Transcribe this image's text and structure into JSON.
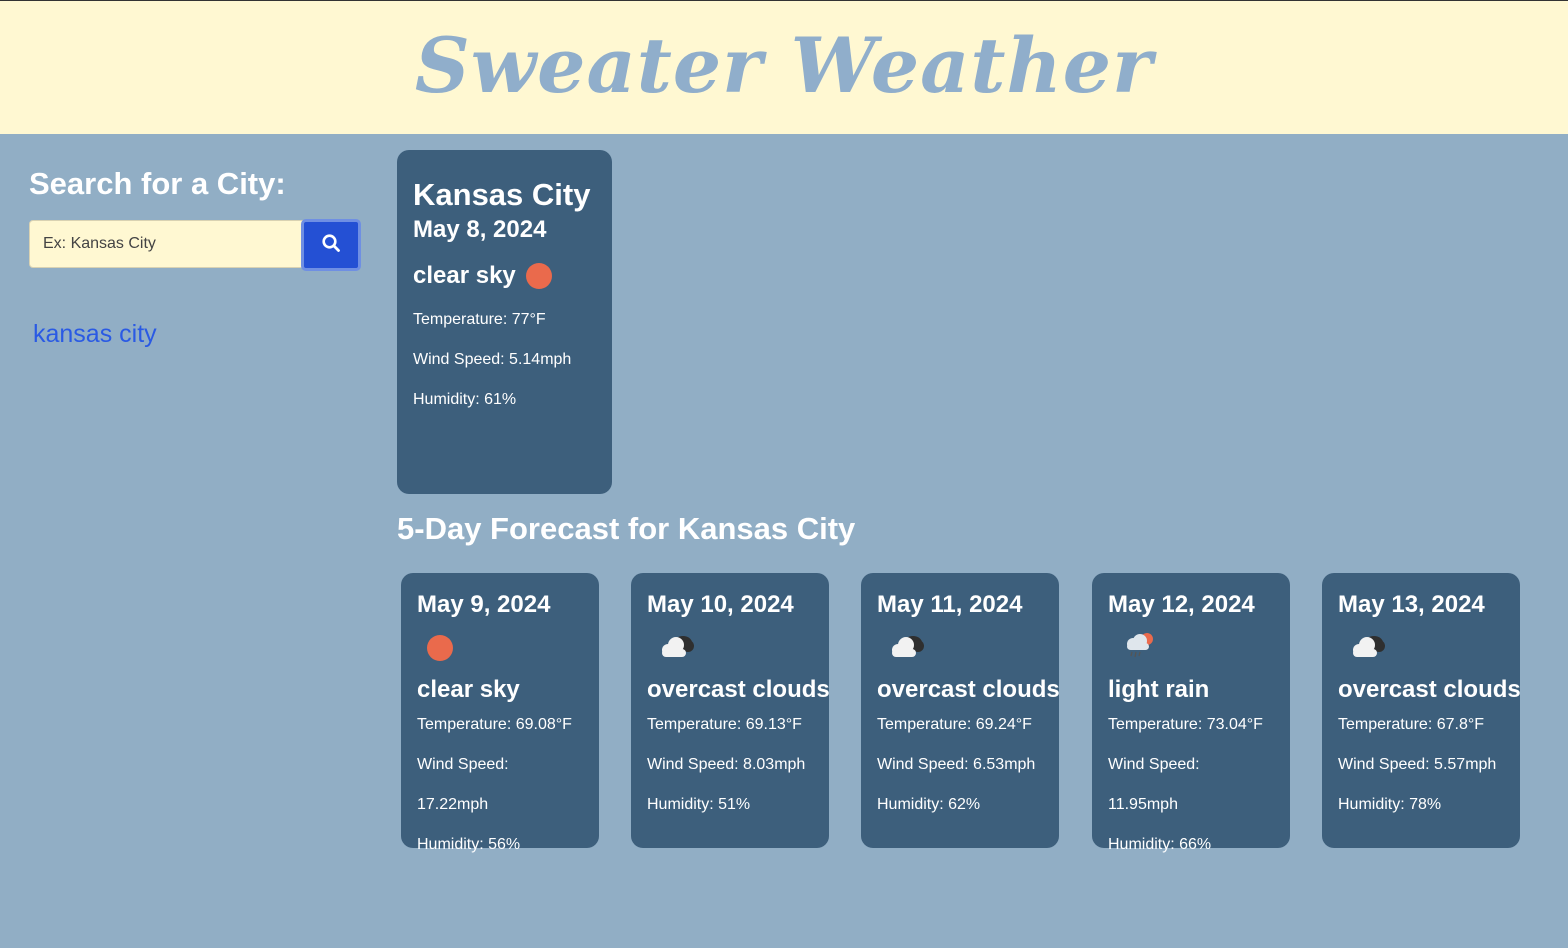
{
  "header": {
    "title": "Sweater Weather"
  },
  "search": {
    "heading": "Search for a City:",
    "placeholder": "Ex: Kansas City",
    "value": "",
    "button_icon": "search-icon"
  },
  "history": [
    {
      "label": "kansas city"
    }
  ],
  "current": {
    "city": "Kansas City",
    "date": "May 8, 2024",
    "condition": "clear sky",
    "icon": "sun-icon",
    "temperature": "Temperature: 77°F",
    "wind": "Wind Speed: 5.14mph",
    "humidity": "Humidity: 61%"
  },
  "forecast": {
    "heading": "5-Day Forecast for Kansas City",
    "days": [
      {
        "date": "May 9, 2024",
        "icon": "sun-icon",
        "condition": "clear sky",
        "temperature": "Temperature: 69.08°F",
        "wind": "Wind Speed: 17.22mph",
        "humidity": "Humidity: 56%"
      },
      {
        "date": "May 10, 2024",
        "icon": "overcast-clouds-icon",
        "condition": "overcast clouds",
        "temperature": "Temperature: 69.13°F",
        "wind": "Wind Speed: 8.03mph",
        "humidity": "Humidity: 51%"
      },
      {
        "date": "May 11, 2024",
        "icon": "overcast-clouds-icon",
        "condition": "overcast clouds",
        "temperature": "Temperature: 69.24°F",
        "wind": "Wind Speed: 6.53mph",
        "humidity": "Humidity: 62%"
      },
      {
        "date": "May 12, 2024",
        "icon": "light-rain-icon",
        "condition": "light rain",
        "temperature": "Temperature: 73.04°F",
        "wind": "Wind Speed: 11.95mph",
        "humidity": "Humidity: 66%"
      },
      {
        "date": "May 13, 2024",
        "icon": "overcast-clouds-icon",
        "condition": "overcast clouds",
        "temperature": "Temperature: 67.8°F",
        "wind": "Wind Speed: 5.57mph",
        "humidity": "Humidity: 78%"
      }
    ]
  },
  "colors": {
    "background": "#91aec5",
    "header_bg": "#fff8d2",
    "title": "#90aecb",
    "card": "#3d5f7c",
    "button": "#2450d4",
    "link": "#2a5ae4",
    "sun": "#ea6a4c"
  }
}
